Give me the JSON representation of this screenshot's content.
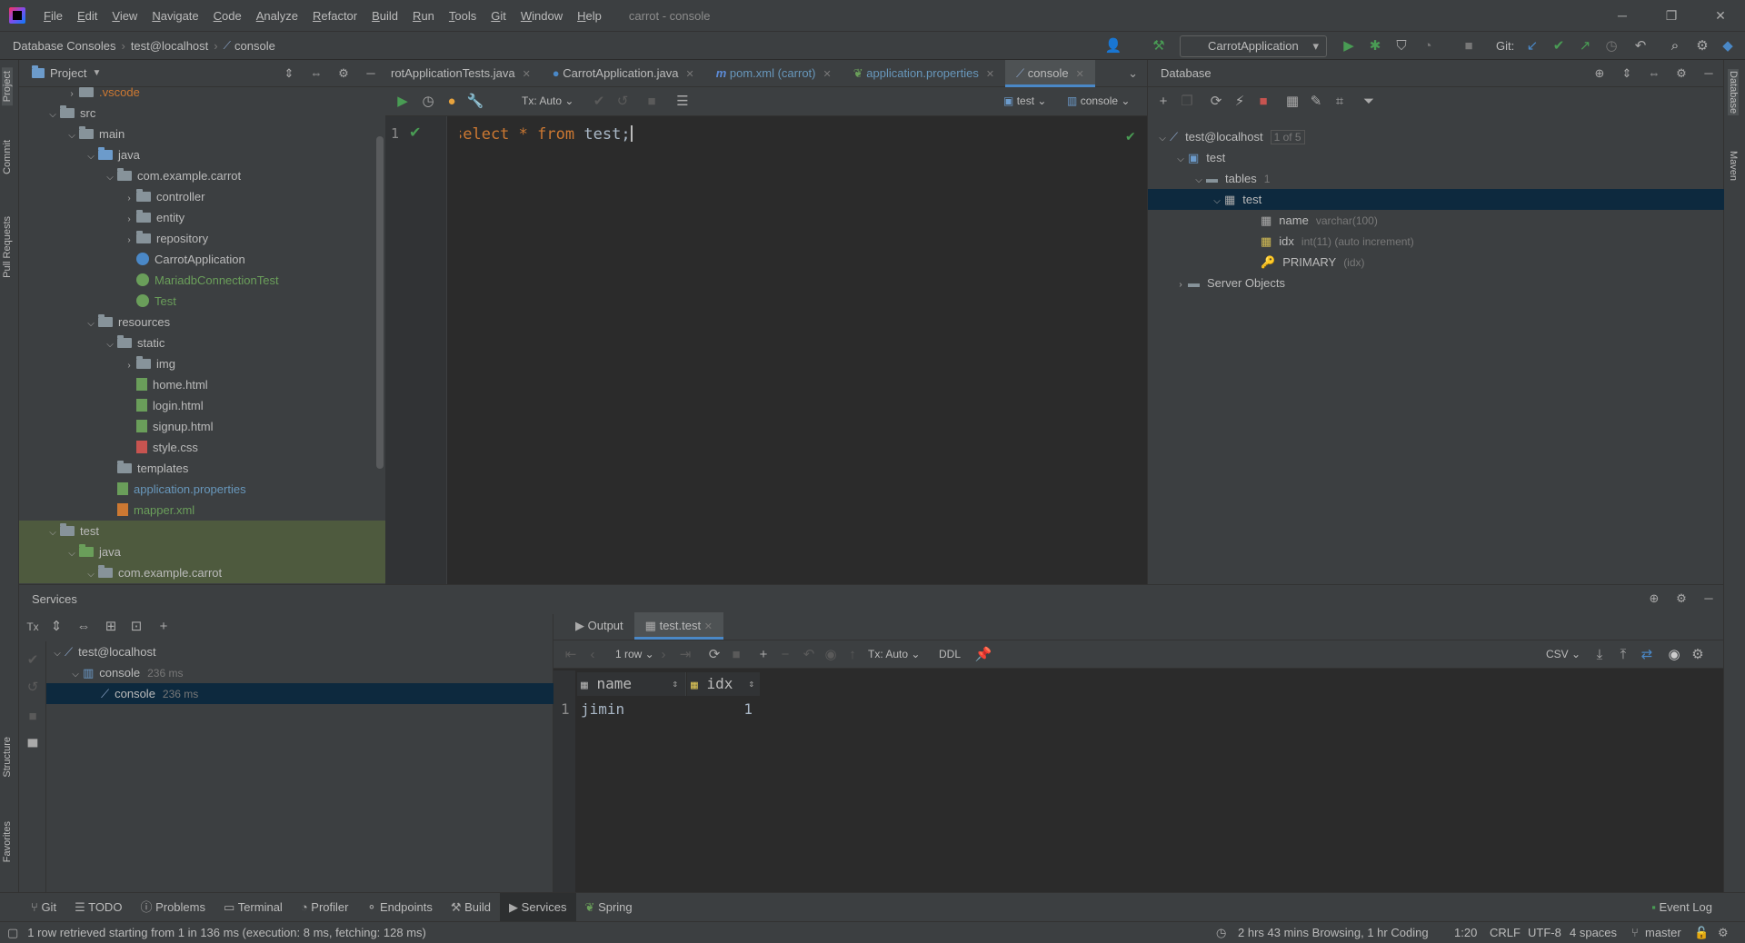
{
  "app": {
    "window_title": "carrot - console"
  },
  "menu": [
    "File",
    "Edit",
    "View",
    "Navigate",
    "Code",
    "Analyze",
    "Refactor",
    "Build",
    "Run",
    "Tools",
    "Git",
    "Window",
    "Help"
  ],
  "window_controls": {
    "minimize": "─",
    "restore": "❐",
    "close": "✕"
  },
  "navbar": {
    "breadcrumbs": [
      "Database Consoles",
      "test@localhost",
      "console"
    ],
    "run_config": "CarrotApplication",
    "git_label": "Git:"
  },
  "left_strip": {
    "tabs": [
      "Project",
      "Commit",
      "Pull Requests",
      "Structure",
      "Favorites"
    ]
  },
  "right_strip": {
    "tabs": [
      "Database",
      "Maven"
    ]
  },
  "project": {
    "header": "Project",
    "rows": [
      {
        "label": ".vscode",
        "kind": "folder",
        "color": "#cc7832"
      },
      {
        "label": "src",
        "kind": "folder"
      },
      {
        "label": "main",
        "kind": "folder"
      },
      {
        "label": "java",
        "kind": "folder-blue"
      },
      {
        "label": "com.example.carrot",
        "kind": "package"
      },
      {
        "label": "controller",
        "kind": "package"
      },
      {
        "label": "entity",
        "kind": "package"
      },
      {
        "label": "repository",
        "kind": "package"
      },
      {
        "label": "CarrotApplication",
        "kind": "class"
      },
      {
        "label": "MariadbConnectionTest",
        "kind": "class-green"
      },
      {
        "label": "Test",
        "kind": "class-green"
      },
      {
        "label": "resources",
        "kind": "folder"
      },
      {
        "label": "static",
        "kind": "folder"
      },
      {
        "label": "img",
        "kind": "folder"
      },
      {
        "label": "home.html",
        "kind": "html"
      },
      {
        "label": "login.html",
        "kind": "html"
      },
      {
        "label": "signup.html",
        "kind": "html"
      },
      {
        "label": "style.css",
        "kind": "css"
      },
      {
        "label": "templates",
        "kind": "folder"
      },
      {
        "label": "application.properties",
        "kind": "props"
      },
      {
        "label": "mapper.xml",
        "kind": "xml"
      },
      {
        "label": "test",
        "kind": "folder"
      },
      {
        "label": "java",
        "kind": "folder-green"
      },
      {
        "label": "com.example.carrot",
        "kind": "package"
      }
    ]
  },
  "editor": {
    "tabs": [
      {
        "label": "rotApplicationTests.java"
      },
      {
        "label": "CarrotApplication.java"
      },
      {
        "label": "pom.xml (carrot)"
      },
      {
        "label": "application.properties"
      },
      {
        "label": "console"
      }
    ],
    "tx_mode": "Tx: Auto",
    "schema": "test",
    "session": "console",
    "line_number": "1",
    "code": {
      "select": "select",
      "star": "*",
      "from": "from",
      "rest": "test;"
    }
  },
  "database": {
    "header": "Database",
    "rows": [
      {
        "label": "test@localhost",
        "meta": "1 of 5"
      },
      {
        "label": "test",
        "meta": ""
      },
      {
        "label": "tables",
        "meta": "1"
      },
      {
        "label": "test",
        "meta": ""
      },
      {
        "label": "name",
        "meta": "varchar(100)"
      },
      {
        "label": "idx",
        "meta": "int(11) (auto increment)"
      },
      {
        "label": "PRIMARY",
        "meta": "(idx)"
      },
      {
        "label": "Server Objects",
        "meta": ""
      }
    ]
  },
  "services": {
    "header": "Services",
    "tree": [
      {
        "label": "test@localhost",
        "meta": ""
      },
      {
        "label": "console",
        "meta": "236 ms"
      },
      {
        "label": "console",
        "meta": "236 ms"
      }
    ],
    "result_tabs": [
      "Output",
      "test.test"
    ],
    "rows_select": "1 row",
    "tx_mode": "Tx: Auto",
    "ddl": "DDL",
    "export_format": "CSV",
    "grid": {
      "columns": [
        "name",
        "idx"
      ],
      "rows": [
        {
          "num": "1",
          "name": "jimin",
          "idx": "1"
        }
      ]
    }
  },
  "bottom_tools": [
    "Git",
    "TODO",
    "Problems",
    "Terminal",
    "Profiler",
    "Endpoints",
    "Build",
    "Services",
    "Spring"
  ],
  "event_log": "Event Log",
  "status": {
    "message": "1 row retrieved starting from 1 in 136 ms (execution: 8 ms, fetching: 128 ms)",
    "time_tracker": "2 hrs 43 mins Browsing, 1 hr Coding",
    "position": "1:20",
    "line_sep": "CRLF",
    "encoding": "UTF-8",
    "indent": "4 spaces",
    "branch": "master"
  },
  "colors": {
    "accent": "#4a88c7",
    "selection": "#0d293e",
    "keyword": "#cc7832",
    "run_green": "#499c54"
  }
}
